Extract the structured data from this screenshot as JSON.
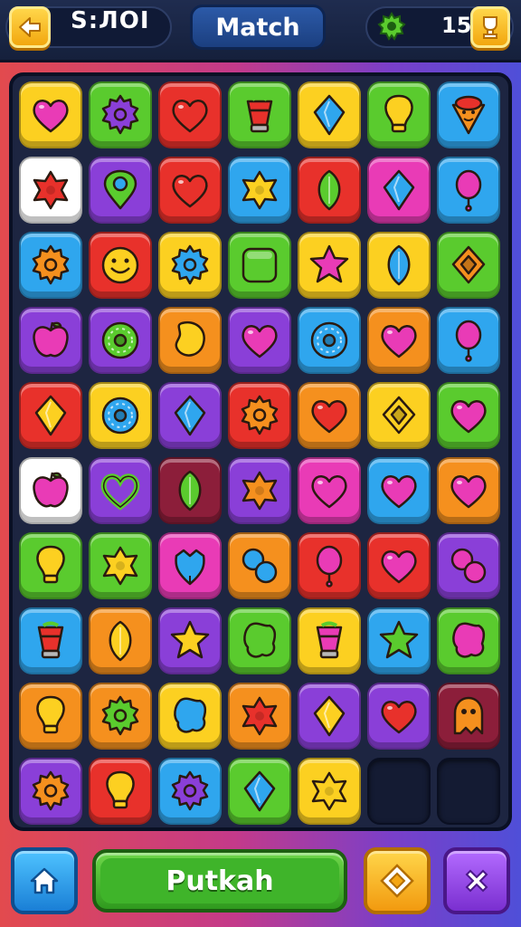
{
  "header": {
    "score_label": "S:ЛОI",
    "title": "Match",
    "moves_count": "15"
  },
  "footer": {
    "primary_label": "Putkah"
  },
  "colors": {
    "red": "#e8312b",
    "orange": "#f5901e",
    "yellow": "#fcd021",
    "green": "#5acb2e",
    "blue": "#2fa6ee",
    "purple": "#8a3fd8",
    "pink": "#e93bb6",
    "white": "#ffffff",
    "maroon": "#8c1e3a"
  },
  "board": {
    "rows": 10,
    "cols": 7,
    "tiles": [
      [
        {
          "bg": "yellow",
          "icon": "heart",
          "fg": "pink"
        },
        {
          "bg": "green",
          "icon": "gear",
          "fg": "purple"
        },
        {
          "bg": "red",
          "icon": "heart",
          "fg": "red"
        },
        {
          "bg": "green",
          "icon": "cup",
          "fg": "red"
        },
        {
          "bg": "yellow",
          "icon": "diamond",
          "fg": "blue"
        },
        {
          "bg": "green",
          "icon": "bulb",
          "fg": "yellow"
        },
        {
          "bg": "blue",
          "icon": "cone",
          "fg": "orange"
        }
      ],
      [
        {
          "bg": "white",
          "icon": "flower",
          "fg": "red"
        },
        {
          "bg": "purple",
          "icon": "pin",
          "fg": "green"
        },
        {
          "bg": "red",
          "icon": "heart",
          "fg": "red"
        },
        {
          "bg": "blue",
          "icon": "flower",
          "fg": "yellow"
        },
        {
          "bg": "red",
          "icon": "leaf",
          "fg": "green"
        },
        {
          "bg": "pink",
          "icon": "diamond",
          "fg": "blue"
        },
        {
          "bg": "blue",
          "icon": "balloon",
          "fg": "pink"
        }
      ],
      [
        {
          "bg": "blue",
          "icon": "gear",
          "fg": "orange"
        },
        {
          "bg": "red",
          "icon": "smile",
          "fg": "yellow"
        },
        {
          "bg": "yellow",
          "icon": "gear",
          "fg": "blue"
        },
        {
          "bg": "green",
          "icon": "square",
          "fg": "green"
        },
        {
          "bg": "yellow",
          "icon": "star",
          "fg": "pink"
        },
        {
          "bg": "yellow",
          "icon": "leaf",
          "fg": "blue"
        },
        {
          "bg": "green",
          "icon": "kite",
          "fg": "orange"
        }
      ],
      [
        {
          "bg": "purple",
          "icon": "apple",
          "fg": "pink"
        },
        {
          "bg": "purple",
          "icon": "donut",
          "fg": "green"
        },
        {
          "bg": "orange",
          "icon": "bean",
          "fg": "yellow"
        },
        {
          "bg": "purple",
          "icon": "heart",
          "fg": "pink"
        },
        {
          "bg": "blue",
          "icon": "donut",
          "fg": "blue"
        },
        {
          "bg": "orange",
          "icon": "heart",
          "fg": "pink"
        },
        {
          "bg": "blue",
          "icon": "balloon",
          "fg": "pink"
        }
      ],
      [
        {
          "bg": "red",
          "icon": "diamond",
          "fg": "yellow"
        },
        {
          "bg": "yellow",
          "icon": "donut",
          "fg": "blue"
        },
        {
          "bg": "purple",
          "icon": "diamond",
          "fg": "blue"
        },
        {
          "bg": "red",
          "icon": "gear",
          "fg": "orange"
        },
        {
          "bg": "orange",
          "icon": "heart",
          "fg": "red"
        },
        {
          "bg": "yellow",
          "icon": "kite",
          "fg": "yellow"
        },
        {
          "bg": "green",
          "icon": "heart",
          "fg": "pink"
        }
      ],
      [
        {
          "bg": "white",
          "icon": "apple",
          "fg": "pink"
        },
        {
          "bg": "purple",
          "icon": "heart-outline",
          "fg": "green"
        },
        {
          "bg": "maroon",
          "icon": "leaf",
          "fg": "green"
        },
        {
          "bg": "purple",
          "icon": "flower",
          "fg": "orange"
        },
        {
          "bg": "pink",
          "icon": "heart",
          "fg": "pink"
        },
        {
          "bg": "blue",
          "icon": "heart",
          "fg": "pink"
        },
        {
          "bg": "orange",
          "icon": "heart",
          "fg": "pink"
        }
      ],
      [
        {
          "bg": "green",
          "icon": "bulb",
          "fg": "yellow"
        },
        {
          "bg": "green",
          "icon": "flower",
          "fg": "yellow"
        },
        {
          "bg": "pink",
          "icon": "drop",
          "fg": "blue"
        },
        {
          "bg": "orange",
          "icon": "bubbles",
          "fg": "blue"
        },
        {
          "bg": "red",
          "icon": "balloon",
          "fg": "pink"
        },
        {
          "bg": "red",
          "icon": "heart",
          "fg": "pink"
        },
        {
          "bg": "purple",
          "icon": "bubbles",
          "fg": "pink"
        }
      ],
      [
        {
          "bg": "blue",
          "icon": "cup",
          "fg": "red"
        },
        {
          "bg": "orange",
          "icon": "leaf",
          "fg": "yellow"
        },
        {
          "bg": "purple",
          "icon": "star",
          "fg": "yellow"
        },
        {
          "bg": "green",
          "icon": "blob",
          "fg": "green"
        },
        {
          "bg": "yellow",
          "icon": "cup",
          "fg": "pink"
        },
        {
          "bg": "blue",
          "icon": "star",
          "fg": "green"
        },
        {
          "bg": "green",
          "icon": "blob",
          "fg": "pink"
        }
      ],
      [
        {
          "bg": "orange",
          "icon": "bulb",
          "fg": "yellow"
        },
        {
          "bg": "orange",
          "icon": "gear",
          "fg": "green"
        },
        {
          "bg": "yellow",
          "icon": "blob",
          "fg": "blue"
        },
        {
          "bg": "orange",
          "icon": "flower",
          "fg": "red"
        },
        {
          "bg": "purple",
          "icon": "diamond",
          "fg": "yellow"
        },
        {
          "bg": "purple",
          "icon": "heart",
          "fg": "red"
        },
        {
          "bg": "maroon",
          "icon": "ghost",
          "fg": "orange"
        }
      ],
      [
        {
          "bg": "purple",
          "icon": "gear",
          "fg": "orange"
        },
        {
          "bg": "red",
          "icon": "bulb",
          "fg": "yellow"
        },
        {
          "bg": "blue",
          "icon": "gear",
          "fg": "purple"
        },
        {
          "bg": "green",
          "icon": "diamond",
          "fg": "blue"
        },
        {
          "bg": "yellow",
          "icon": "flower",
          "fg": "yellow"
        },
        {
          "bg": "empty",
          "icon": "none",
          "fg": "none"
        },
        {
          "bg": "empty",
          "icon": "none",
          "fg": "none"
        }
      ]
    ]
  }
}
